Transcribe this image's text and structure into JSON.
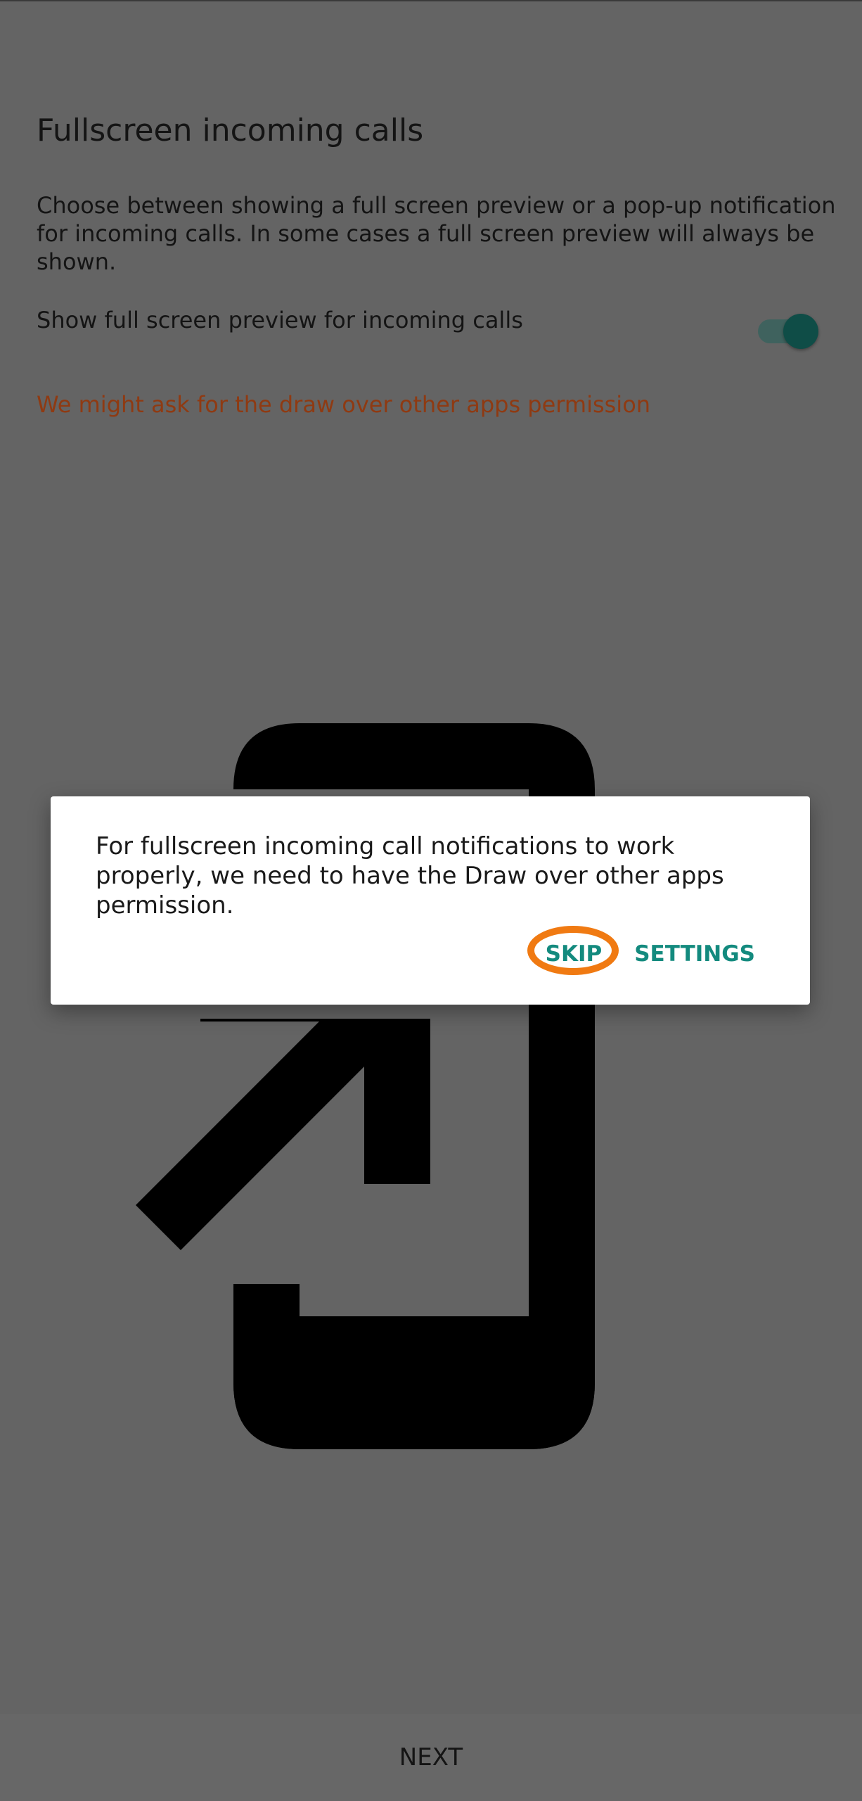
{
  "page": {
    "title": "Fullscreen incoming calls",
    "description": "Choose between showing a full screen preview or a pop-up notification for incoming calls. In some cases a full screen preview will always be shown.",
    "setting_label": "Show full screen preview for incoming calls",
    "setting_enabled": true,
    "permission_note": "We might ask for the draw over other apps permission"
  },
  "dialog": {
    "message": "For fullscreen incoming call notifications to work properly, we need to have the Draw over other apps permission.",
    "skip_label": "SKIP",
    "settings_label": "SETTINGS"
  },
  "footer": {
    "next_label": "NEXT"
  },
  "colors": {
    "accent": "#138a7e",
    "highlight_ring": "#f07a12",
    "warning_text": "#8f3a12",
    "scrim_background": "#646464"
  },
  "icons": {
    "illustration": "open-in-new-window-icon"
  }
}
